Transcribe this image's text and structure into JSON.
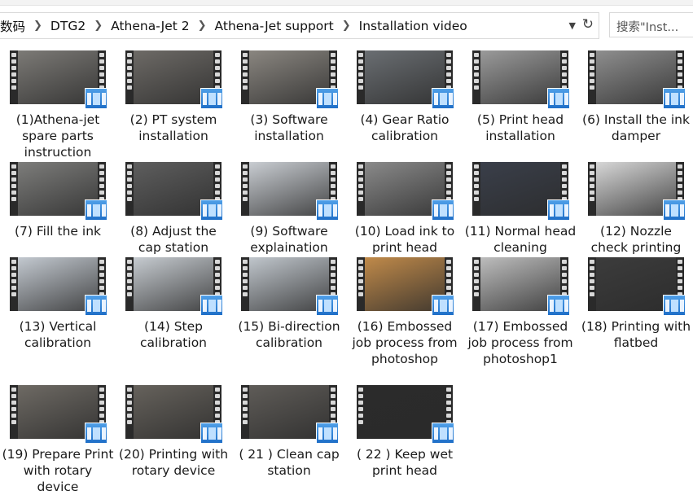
{
  "breadcrumb": [
    "数码",
    "DTG2",
    "Athena-Jet 2",
    "Athena-Jet support",
    "Installation video"
  ],
  "search_placeholder": "搜索\"Inst...",
  "videos": [
    {
      "label": "(1)Athena-jet spare parts instruction",
      "thumb": "#7c7a76"
    },
    {
      "label": "(2) PT system installation",
      "thumb": "#6d6a66"
    },
    {
      "label": "(3) Software installation",
      "thumb": "#8a8680"
    },
    {
      "label": "(4) Gear Ratio calibration",
      "thumb": "#6a6e72"
    },
    {
      "label": "(5) Print head installation",
      "thumb": "#9a9a9a"
    },
    {
      "label": "(6) Install the ink damper",
      "thumb": "#8e8e8e"
    },
    {
      "label": "(7) Fill the ink",
      "thumb": "#7d7d7b"
    },
    {
      "label": "(8) Adjust the cap station",
      "thumb": "#5e5e5e"
    },
    {
      "label": "(9) Software explaination",
      "thumb": "#c9cdd2"
    },
    {
      "label": "(10) Load ink to print head",
      "thumb": "#8a8a8a"
    },
    {
      "label": "(11) Normal head cleaning",
      "thumb": "#3a3f4a"
    },
    {
      "label": "(12) Nozzle check printing",
      "thumb": "#d7d7d7"
    },
    {
      "label": "(13) Vertical calibration",
      "thumb": "#c3c9d0"
    },
    {
      "label": "(14) Step calibration",
      "thumb": "#c6cbd0"
    },
    {
      "label": "(15) Bi-direction calibration",
      "thumb": "#c0c6cc"
    },
    {
      "label": "(16) Embossed job process from photoshop",
      "thumb": "#c08a4a"
    },
    {
      "label": "(17) Embossed job process from photoshop1",
      "thumb": "#bdbdbd"
    },
    {
      "label": "(18) Printing with flatbed",
      "thumb": "#3c3c3c"
    },
    {
      "label": "(19) Prepare Print with rotary device",
      "thumb": "#6e6a64"
    },
    {
      "label": "(20) Printing with rotary device",
      "thumb": "#66625c"
    },
    {
      "label": "( 21 ) Clean cap station",
      "thumb": "#5f5c58"
    },
    {
      "label": "( 22 ) Keep wet print head",
      "thumb": "#2b2b2b"
    }
  ]
}
